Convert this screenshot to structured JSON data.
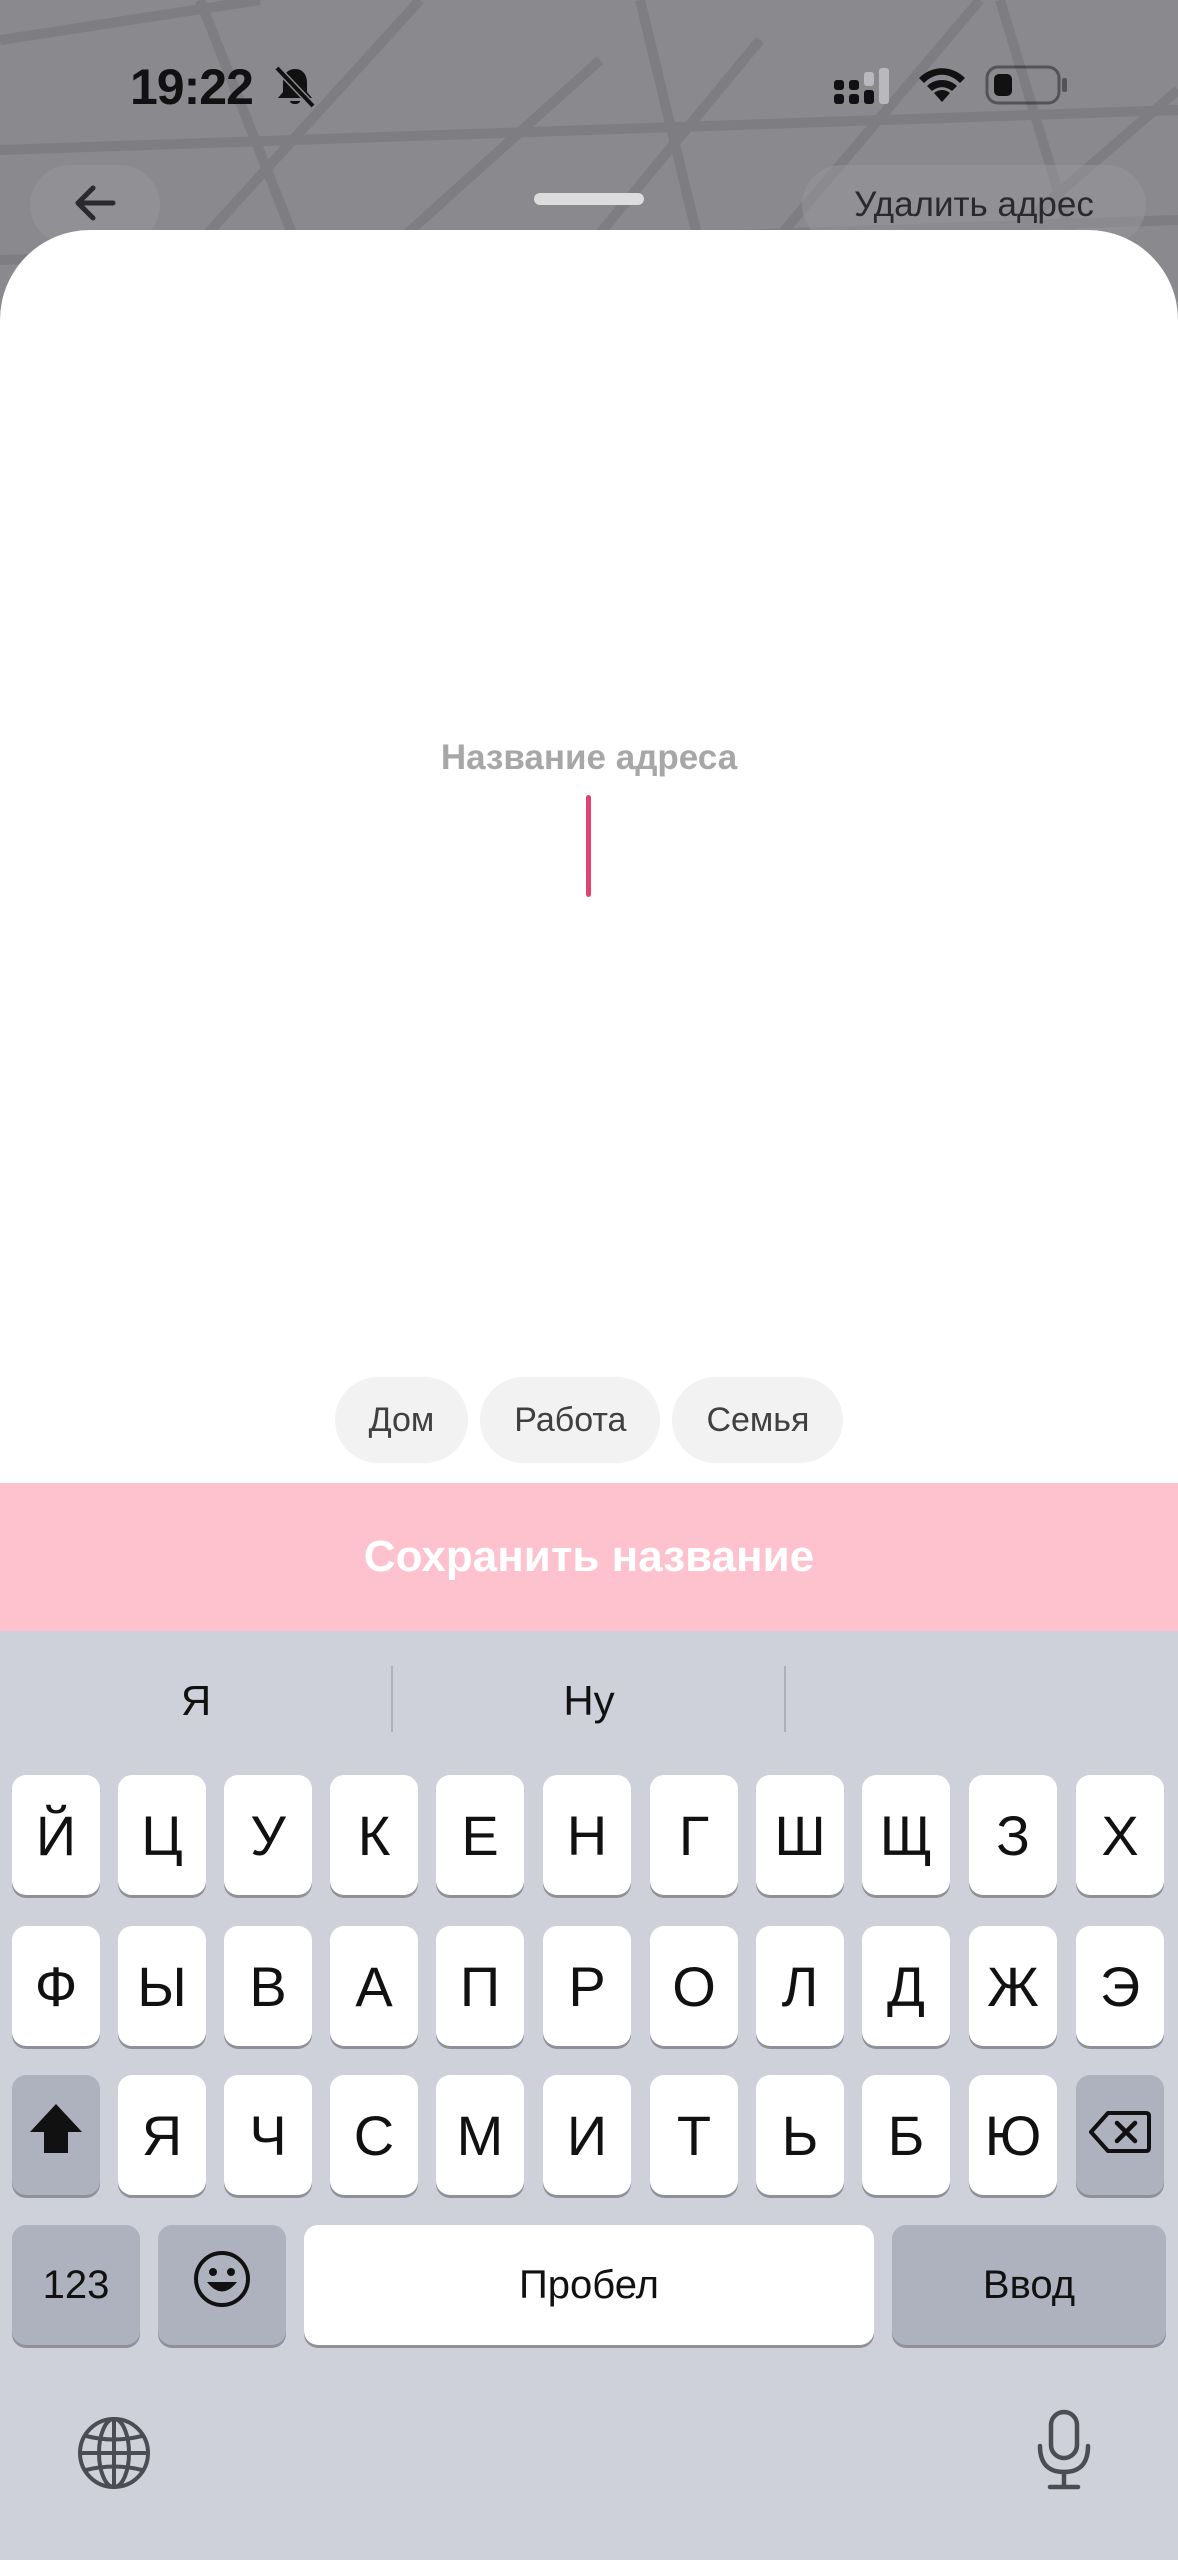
{
  "status_bar": {
    "time": "19:22",
    "icons": [
      "bell-slash-icon",
      "cellular-signal-icon",
      "wifi-icon",
      "battery-icon"
    ]
  },
  "header": {
    "back_icon": "arrow-left-icon",
    "delete_label": "Удалить адрес"
  },
  "form": {
    "field_label": "Название адреса",
    "value": "",
    "chips": [
      {
        "label": "Дом"
      },
      {
        "label": "Работа"
      },
      {
        "label": "Семья"
      }
    ],
    "save_label": "Сохранить название"
  },
  "keyboard": {
    "suggestions": [
      "Я",
      "Ну",
      ""
    ],
    "row1": [
      "Й",
      "Ц",
      "У",
      "К",
      "Е",
      "Н",
      "Г",
      "Ш",
      "Щ",
      "З",
      "Х"
    ],
    "row2": [
      "Ф",
      "Ы",
      "В",
      "А",
      "П",
      "Р",
      "О",
      "Л",
      "Д",
      "Ж",
      "Э"
    ],
    "row3": [
      "Я",
      "Ч",
      "С",
      "М",
      "И",
      "Т",
      "Ь",
      "Б",
      "Ю"
    ],
    "numbers_label": "123",
    "space_label": "Пробел",
    "return_label": "Ввод",
    "icons": [
      "shift-icon",
      "backspace-icon",
      "emoji-icon",
      "globe-icon",
      "microphone-icon"
    ]
  },
  "colors": {
    "accent": "#e0436f",
    "save_button_bg": "#fec2ce",
    "chip_bg": "#f2f2f2",
    "keyboard_bg": "#cfd1da"
  }
}
